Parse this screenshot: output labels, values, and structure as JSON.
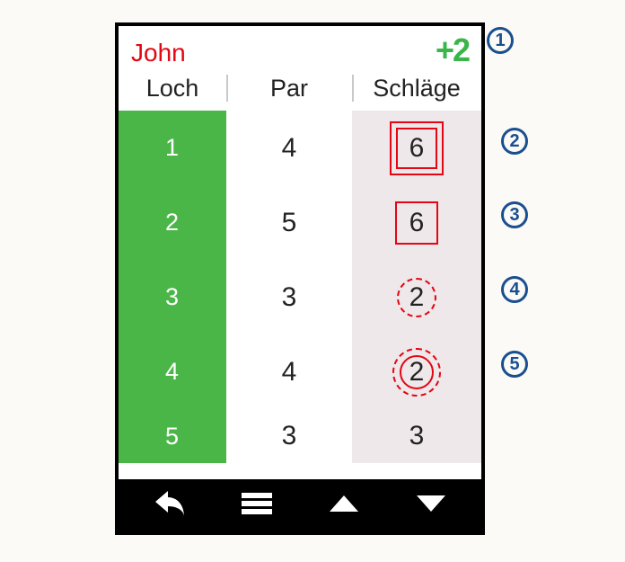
{
  "header": {
    "player_name": "John",
    "score_delta": "+2"
  },
  "columns": {
    "hole": "Loch",
    "par": "Par",
    "strokes": "Schläge"
  },
  "rows": [
    {
      "hole": "1",
      "par": "4",
      "strokes": "6",
      "marker": "dsquare"
    },
    {
      "hole": "2",
      "par": "5",
      "strokes": "6",
      "marker": "square"
    },
    {
      "hole": "3",
      "par": "3",
      "strokes": "2",
      "marker": "dcircle"
    },
    {
      "hole": "4",
      "par": "4",
      "strokes": "2",
      "marker": "ddcircle"
    },
    {
      "hole": "5",
      "par": "3",
      "strokes": "3",
      "marker": ""
    }
  ],
  "callouts": [
    "1",
    "2",
    "3",
    "4",
    "5"
  ]
}
